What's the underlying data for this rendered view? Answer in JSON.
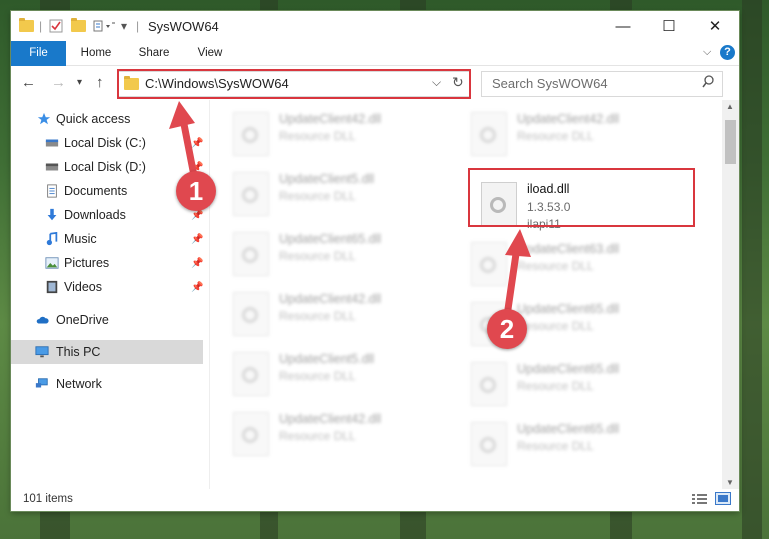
{
  "window": {
    "title": "SysWOW64",
    "controls": {
      "minimize": "—",
      "maximize": "☐",
      "close": "✕"
    }
  },
  "ribbon": {
    "tabs": [
      {
        "label": "File"
      },
      {
        "label": "Home"
      },
      {
        "label": "Share"
      },
      {
        "label": "View"
      }
    ],
    "expand_icon": "chevron-down-icon",
    "help_label": "?"
  },
  "address": {
    "path": "C:\\Windows\\SysWOW64",
    "search_placeholder": "Search SysWOW64"
  },
  "sidebar": {
    "items": [
      {
        "label": "Quick access",
        "icon": "star-icon",
        "pinned": false
      },
      {
        "label": "Local Disk (C:)",
        "icon": "drive-icon",
        "pinned": true
      },
      {
        "label": "Local Disk (D:)",
        "icon": "drive-icon",
        "pinned": true
      },
      {
        "label": "Documents",
        "icon": "documents-icon",
        "pinned": true
      },
      {
        "label": "Downloads",
        "icon": "download-icon",
        "pinned": true
      },
      {
        "label": "Music",
        "icon": "music-icon",
        "pinned": true
      },
      {
        "label": "Pictures",
        "icon": "pictures-icon",
        "pinned": true
      },
      {
        "label": "Videos",
        "icon": "videos-icon",
        "pinned": true
      },
      {
        "label": "OneDrive",
        "icon": "cloud-icon",
        "pinned": false
      },
      {
        "label": "This PC",
        "icon": "computer-icon",
        "pinned": false,
        "selected": true
      },
      {
        "label": "Network",
        "icon": "network-icon",
        "pinned": false
      }
    ]
  },
  "files": {
    "left_column": [
      {
        "name": "UpdateClient42.dll",
        "desc": "Resource DLL"
      },
      {
        "name": "UpdateClient5.dll",
        "desc": "Resource DLL"
      },
      {
        "name": "UpdateClient65.dll",
        "desc": "Resource DLL"
      },
      {
        "name": "UpdateClient42.dll",
        "desc": "Resource DLL"
      },
      {
        "name": "UpdateClient5.dll",
        "desc": "Resource DLL"
      },
      {
        "name": "UpdateClient42.dll",
        "desc": "Resource DLL"
      }
    ],
    "right_column": [
      {
        "name": "UpdateClient42.dll",
        "desc": "Resource DLL"
      },
      {
        "name": "UpdateClient63.dll",
        "desc": "Resource DLL"
      },
      {
        "name": "UpdateClient65.dll",
        "desc": "Resource DLL"
      },
      {
        "name": "UpdateClient65.dll",
        "desc": "Resource DLL"
      },
      {
        "name": "UpdateClient65.dll",
        "desc": "Resource DLL"
      }
    ],
    "highlighted": {
      "name": "iload.dll",
      "version": "1.3.53.0",
      "desc": "ilapi11"
    }
  },
  "status": {
    "item_count": "101 items"
  },
  "annotations": {
    "step1": "1",
    "step2": "2",
    "accent": "#d9363e"
  }
}
